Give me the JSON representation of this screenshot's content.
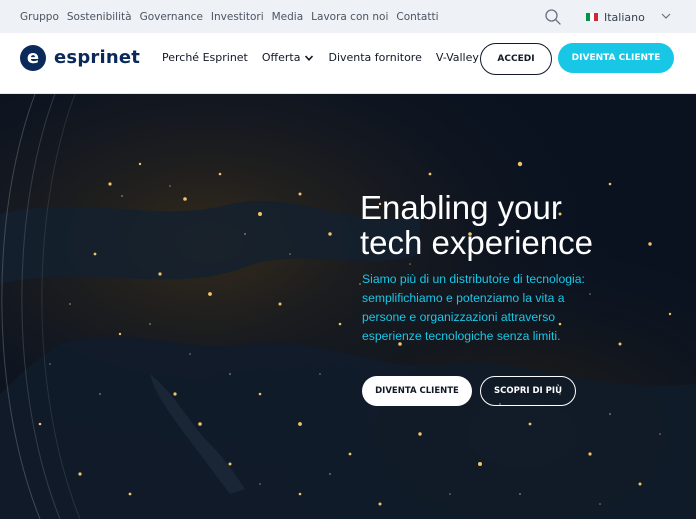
{
  "topbar": {
    "links": [
      "Gruppo",
      "Sostenibilità",
      "Governance",
      "Investitori",
      "Media",
      "Lavora con noi",
      "Contatti"
    ],
    "language": "Italiano",
    "flag_colors": [
      "#009246",
      "#ffffff",
      "#ce2b37"
    ]
  },
  "navbar": {
    "logo_text": "esprinet",
    "logo_letter": "e",
    "items": [
      {
        "label": "Perché Esprinet",
        "has_dropdown": false
      },
      {
        "label": "Offerta",
        "has_dropdown": true
      },
      {
        "label": "Diventa fornitore",
        "has_dropdown": false
      },
      {
        "label": "V-Valley",
        "has_dropdown": false
      }
    ],
    "login_label": "ACCEDI",
    "cta_label": "DIVENTA CLIENTE"
  },
  "hero": {
    "title_lines": [
      "Enabling your",
      "tech experience"
    ],
    "subtitle_lines": [
      "Siamo più di un distributore di tecnologia:",
      "semplifichiamo e potenziamo la vita a",
      "persone e organizzazioni attraverso",
      "esperienze tecnologiche senza limiti."
    ],
    "primary_button": "DIVENTA CLIENTE",
    "secondary_button": "SCOPRI DI PIÙ"
  },
  "colors": {
    "brand_navy": "#0b2a5b",
    "accent_cyan": "#18c7e6",
    "topbar_bg": "#eef1f5",
    "hero_bg": "#0b1424"
  },
  "icons": {
    "search": "search-icon",
    "chevron": "chevron-down-icon",
    "flag": "italy-flag-icon"
  }
}
